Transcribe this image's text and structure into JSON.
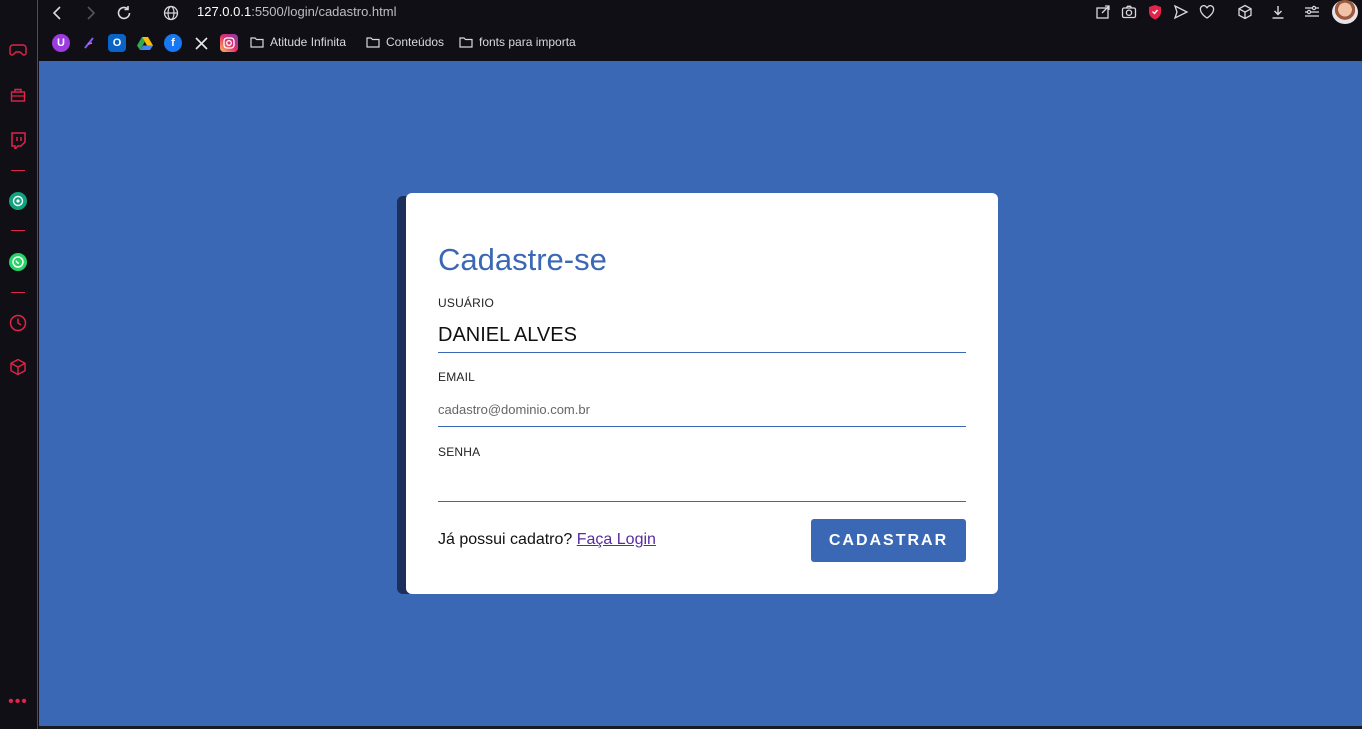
{
  "browser": {
    "url_host": "127.0.0.1",
    "url_rest": ":5500/login/cadastro.html"
  },
  "bookmarks": {
    "folders": [
      {
        "label": "Atitude Infinita"
      },
      {
        "label": "Conteúdos"
      },
      {
        "label": "fonts para importa"
      }
    ]
  },
  "sidebar": {
    "items": [
      "gamepad-icon",
      "briefcase-icon",
      "twitch-icon",
      "chatgpt-icon",
      "whatsapp-icon",
      "history-icon",
      "cube-icon"
    ],
    "more": "•••"
  },
  "form": {
    "title": "Cadastre-se",
    "user_label": "USUÁRIO",
    "user_value": "DANIEL ALVES",
    "email_label": "EMAIL",
    "email_placeholder": "cadastro@dominio.com.br",
    "password_label": "SENHA",
    "login_prompt": "Já possui cadatro? ",
    "login_link": "Faça Login",
    "submit_label": "CADASTRAR"
  },
  "colors": {
    "background": "#3b68b5",
    "accent": "#3b68b5",
    "sidebar_accent": "#e0244a",
    "link": "#5a2aa0"
  }
}
